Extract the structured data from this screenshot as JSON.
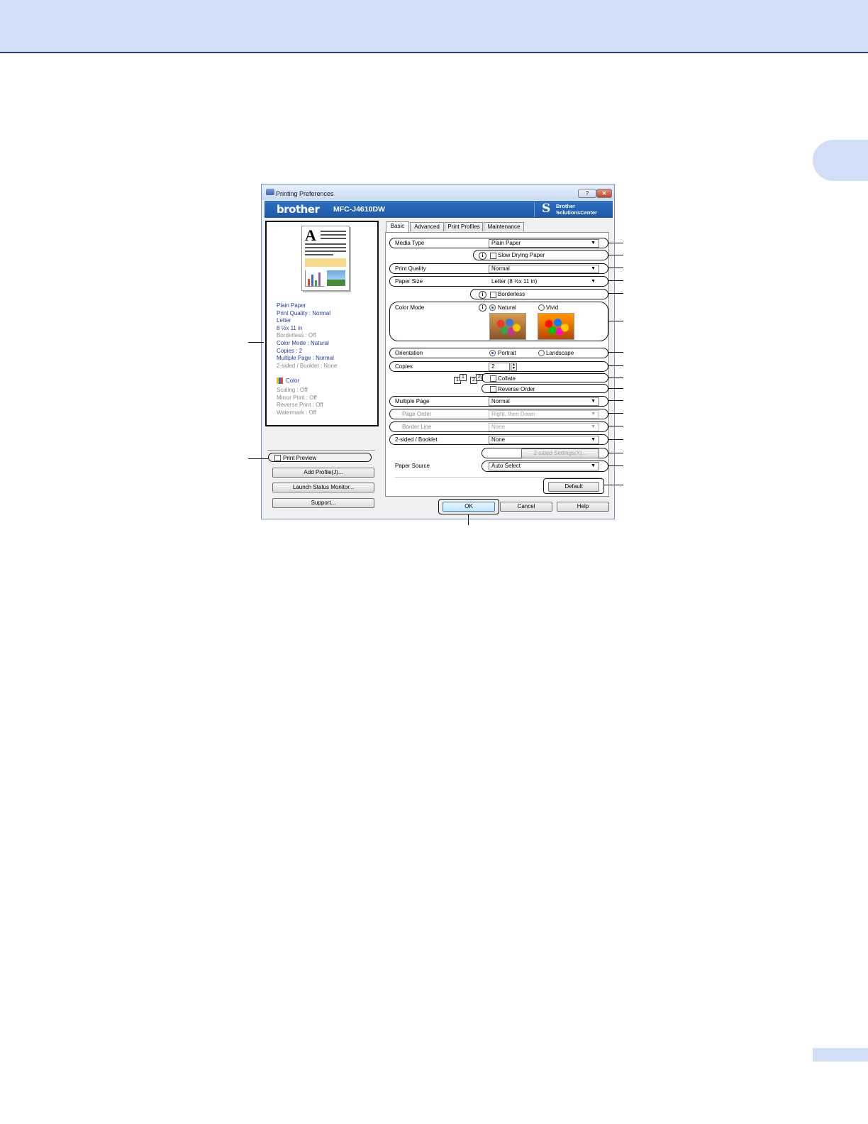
{
  "window": {
    "title": "Printing Preferences",
    "help_glyph": "?",
    "close_glyph": "✕"
  },
  "banner": {
    "brand": "brother",
    "model": "MFC-J4610DW",
    "solutions_line1": "Brother",
    "solutions_line2": "SolutionsCenter"
  },
  "preview": {
    "summary": [
      "Plain Paper",
      "Print Quality : Normal",
      "Letter",
      "8 ½x 11 in",
      "Borderless : Off",
      "Color Mode : Natural",
      "Copies : 2",
      "Multiple Page : Normal",
      "2-sided / Booklet : None"
    ],
    "color_label": "Color",
    "summary2": [
      "Scaling : Off",
      "Mirror Print : Off",
      "Reverse Print : Off",
      "Watermark : Off"
    ]
  },
  "left_controls": {
    "print_preview": "Print Preview",
    "add_profile": "Add Profile(J)...",
    "launch_status_monitor": "Launch Status Monitor...",
    "support": "Support..."
  },
  "tabs": [
    "Basic",
    "Advanced",
    "Print Profiles",
    "Maintenance"
  ],
  "basic": {
    "media_type_label": "Media Type",
    "media_type_value": "Plain Paper",
    "slow_drying": "Slow Drying Paper",
    "print_quality_label": "Print Quality",
    "print_quality_value": "Normal",
    "paper_size_label": "Paper Size",
    "paper_size_value": "Letter (8 ½x 11 in)",
    "borderless": "Borderless",
    "color_mode_label": "Color Mode",
    "natural": "Natural",
    "vivid": "Vivid",
    "orientation_label": "Orientation",
    "portrait": "Portrait",
    "landscape": "Landscape",
    "copies_label": "Copies",
    "copies_value": "2",
    "collate": "Collate",
    "reverse_order": "Reverse Order",
    "multiple_page_label": "Multiple Page",
    "multiple_page_value": "Normal",
    "page_order_label": "Page Order",
    "page_order_value": "Right, then Down",
    "border_line_label": "Border Line",
    "border_line_value": "None",
    "two_sided_label": "2-sided / Booklet",
    "two_sided_value": "None",
    "two_sided_settings": "2-sided Settings(X)...",
    "paper_source_label": "Paper Source",
    "paper_source_value": "Auto Select",
    "default_button": "Default"
  },
  "footer": {
    "ok": "OK",
    "cancel": "Cancel",
    "help": "Help"
  },
  "colors": {
    "band": "#d2def8",
    "band_border": "#24408a",
    "banner": "#1f58a8"
  }
}
